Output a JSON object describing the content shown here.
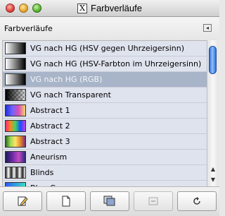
{
  "window": {
    "title": "Farbverläufe"
  },
  "dock": {
    "label": "Farbverläufe"
  },
  "gradients": [
    {
      "label": "VG nach HG (HSV gegen Uhrzeigersinn)",
      "swatch": "linear-gradient(90deg,#ffffff,#000000)",
      "selected": false
    },
    {
      "label": "VG nach HG (HSV-Farbton im Uhrzeigersinn)",
      "swatch": "linear-gradient(90deg,#ffffff,#000000)",
      "selected": false
    },
    {
      "label": "VG nach HG (RGB)",
      "swatch": "linear-gradient(90deg,#ffffff,#000000)",
      "selected": true
    },
    {
      "label": "VG nach Transparent",
      "swatch": "linear-gradient(90deg,#000000,rgba(0,0,0,0)), repeating-conic-gradient(#999 0 25%,#ddd 0 50%) 0 0/6px 6px",
      "selected": false
    },
    {
      "label": "Abstract 1",
      "swatch": "linear-gradient(90deg,#2230d8,#6f62ff,#d94fb3,#f5d56a)",
      "selected": false
    },
    {
      "label": "Abstract 2",
      "swatch": "linear-gradient(90deg,#ff2a6f,#f58a1f,#3fd36a,#1a4dff,#c43cff)",
      "selected": false
    },
    {
      "label": "Abstract 3",
      "swatch": "linear-gradient(90deg,#2a6a1f,#9fdc55,#ffe26b,#e58a2a,#7a2a7a)",
      "selected": false
    },
    {
      "label": "Aneurism",
      "swatch": "linear-gradient(90deg,#1b1b55,#6b2aa6,#c14cbf,#2a2a80)",
      "selected": false
    },
    {
      "label": "Blinds",
      "swatch": "repeating-linear-gradient(90deg,#222 0,#fff 4px,#222 8px)",
      "selected": false
    },
    {
      "label": "Blue Green",
      "swatch": "linear-gradient(90deg,#2a5bff,#35e0c0)",
      "selected": false
    }
  ],
  "toolbar": {
    "buttons": [
      {
        "icon": "edit-gradient-icon",
        "disabled": false
      },
      {
        "icon": "new-gradient-icon",
        "disabled": false
      },
      {
        "icon": "duplicate-gradient-icon",
        "disabled": false
      },
      {
        "icon": "delete-gradient-icon",
        "disabled": true
      },
      {
        "icon": "refresh-gradients-icon",
        "disabled": false
      }
    ]
  }
}
